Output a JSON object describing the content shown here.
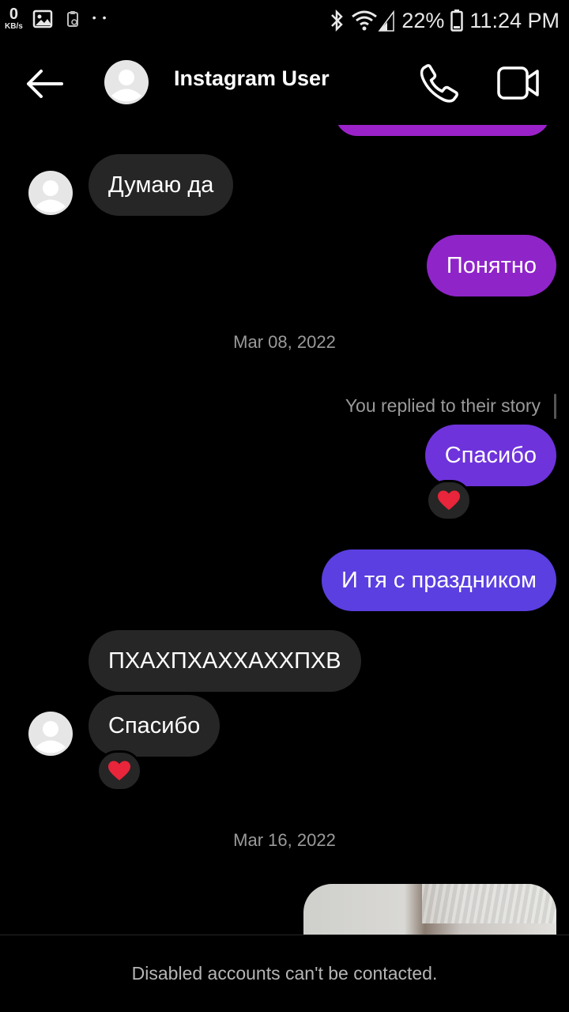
{
  "status_bar": {
    "net_speed": "0",
    "net_unit": "KB/s",
    "battery": "22%",
    "time": "11:24 PM"
  },
  "header": {
    "title": "Instagram User"
  },
  "chat": {
    "messages": [
      {
        "from": "them",
        "text": "Думаю да"
      },
      {
        "from": "me",
        "text": "Понятно"
      },
      {
        "type": "date",
        "text": "Mar 08, 2022"
      },
      {
        "type": "note",
        "text": "You replied to their story"
      },
      {
        "from": "me",
        "text": "Спасибо",
        "reaction": "heart"
      },
      {
        "from": "me",
        "text": "И тя с праздником"
      },
      {
        "from": "them",
        "text": "ПХАХПХАХХАХХПХВ"
      },
      {
        "from": "them",
        "text": "Спасибо",
        "reaction": "heart"
      },
      {
        "type": "date",
        "text": "Mar 16, 2022"
      },
      {
        "from": "me",
        "type": "photo"
      }
    ]
  },
  "footer": {
    "notice": "Disabled accounts can't be contacted."
  },
  "colors": {
    "incoming_bubble": "#262626",
    "outgoing_purple": "#8f24c9",
    "outgoing_violet": "#6e33db",
    "outgoing_indigo": "#5b3fe0",
    "heart": "#e8253a"
  },
  "icons": [
    "back-arrow-icon",
    "phone-icon",
    "video-camera-icon",
    "heart-reaction-icon"
  ]
}
